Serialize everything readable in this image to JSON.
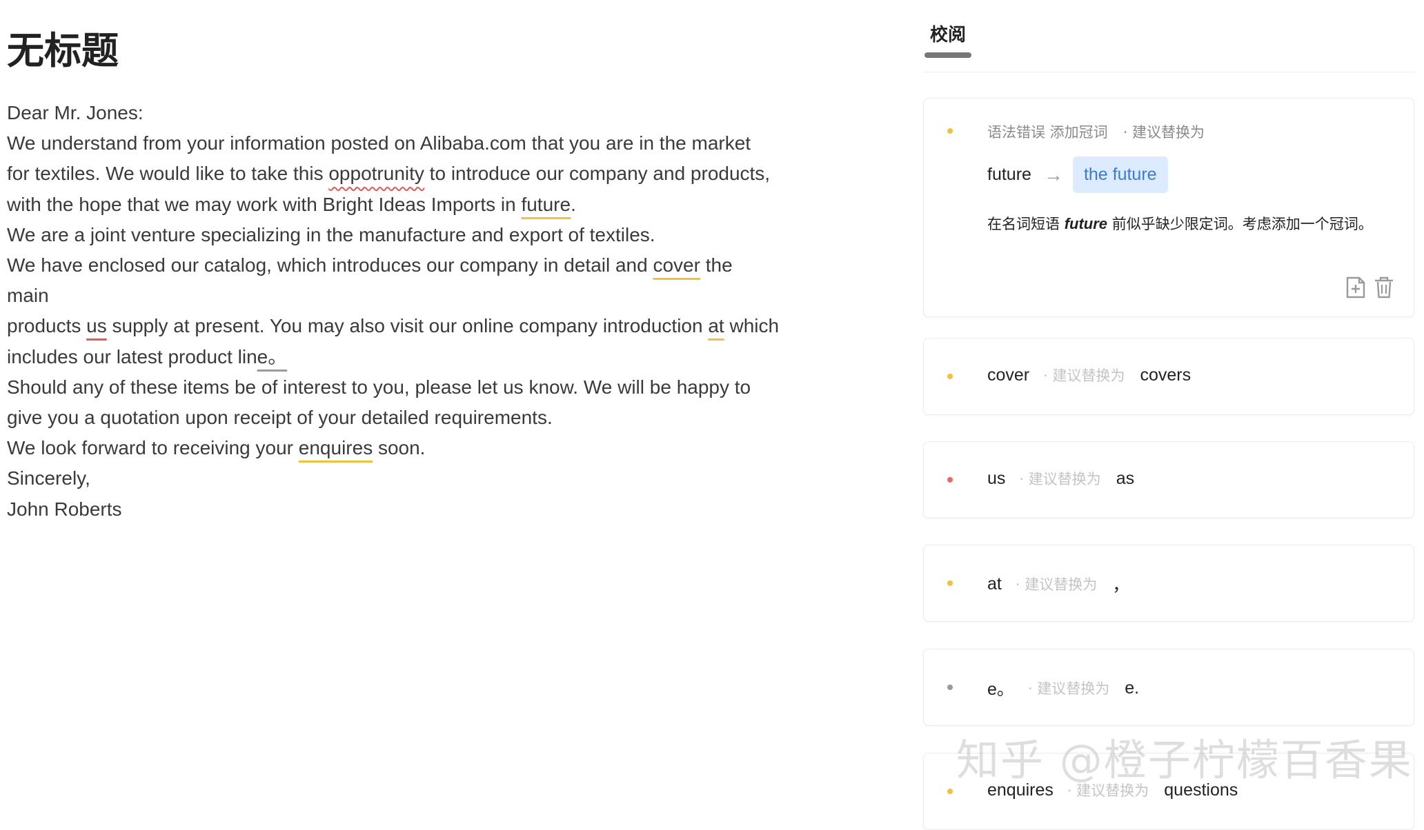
{
  "document": {
    "title": "无标题",
    "lines": {
      "l1": "Dear Mr. Jones:",
      "l2": "We understand from your information posted on Alibaba.com that you are in the market",
      "l3a": "for textiles. We would like to take this ",
      "l3err": "oppotrunity",
      "l3b": " to introduce our company and products,",
      "l4a": "with the hope that we may work with Bright Ideas Imports in ",
      "l4err": " future",
      "l4b": ".",
      "l5": "We are a joint venture specializing in the manufacture and export of textiles.",
      "l6a": "We have enclosed our catalog, which introduces our company in detail and ",
      "l6err": "cover",
      "l6b": " the main",
      "l7a": "products ",
      "l7err": "us",
      "l7b": " supply at present. You may also visit our online company introduction ",
      "l7err2": "at",
      "l7c": " which",
      "l8a": "includes our latest product lin",
      "l8err": "e。",
      "l9": "Should any of these items be of interest to you, please let us know. We will be happy to",
      "l10": "give you a quotation upon receipt of your detailed requirements.",
      "l11a": "We look forward to receiving your ",
      "l11err": "enquires",
      "l11b": " soon.",
      "l12": "Sincerely,",
      "l13": "John Roberts"
    }
  },
  "panel": {
    "tab": "校阅",
    "suggest_label": "· 建议替换为",
    "expanded": {
      "category": "语法错误 添加冠词",
      "original": "future",
      "suggestion": "the future",
      "explain_pre": "在名词短语 ",
      "explain_kw": "future",
      "explain_post": " 前似乎缺少限定词。考虑添加一个冠词。",
      "dot_color": "#efc23e"
    },
    "cards": [
      {
        "original": "cover",
        "suggestion": "covers",
        "dot_color": "#efc23e"
      },
      {
        "original": "us",
        "suggestion": "as",
        "dot_color": "#e86a6a"
      },
      {
        "original": "at",
        "suggestion": "，",
        "dot_color": "#efc23e"
      },
      {
        "original": "e。",
        "suggestion": "e.",
        "dot_color": "#9a9a9a"
      },
      {
        "original": "enquires",
        "suggestion": "questions",
        "dot_color": "#efc23e"
      }
    ]
  },
  "watermark": "知乎 @橙子柠檬百香果",
  "colors": {
    "accent_blue": "#3d7bd1",
    "chip_bg": "#dcebff",
    "warning": "#efc23e",
    "error": "#e86a6a"
  }
}
